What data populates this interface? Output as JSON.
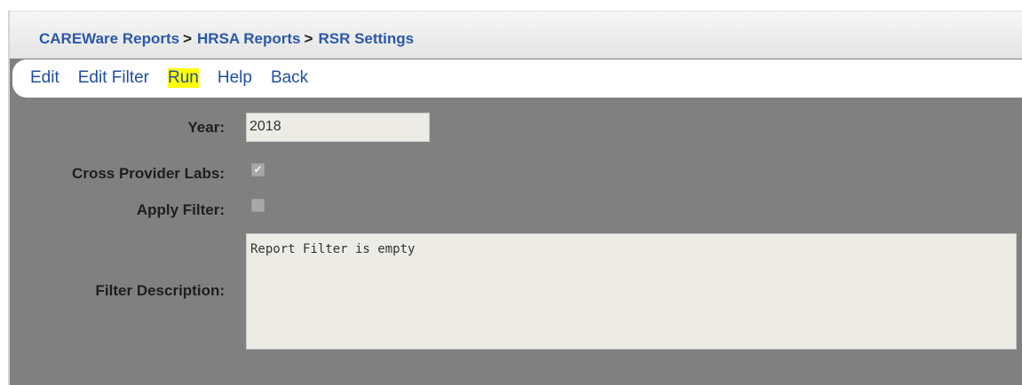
{
  "breadcrumb": {
    "items": [
      "CAREWare Reports",
      "HRSA Reports"
    ],
    "separator": ">",
    "current": "RSR Settings"
  },
  "menu": {
    "edit": "Edit",
    "edit_filter": "Edit Filter",
    "run": "Run",
    "help": "Help",
    "back": "Back"
  },
  "form": {
    "year_label": "Year:",
    "year_value": "2018",
    "cross_provider_labs_label": "Cross Provider Labs:",
    "cross_provider_labs_checked": true,
    "cross_provider_labs_glyph": "✔",
    "apply_filter_label": "Apply Filter:",
    "apply_filter_checked": false,
    "filter_description_label": "Filter Description:",
    "filter_description_value": "Report Filter is empty"
  },
  "colors": {
    "link": "#1f4fa3",
    "panel_bg": "#808080",
    "highlight": "#ffff00",
    "field_bg": "#ecebe6"
  }
}
